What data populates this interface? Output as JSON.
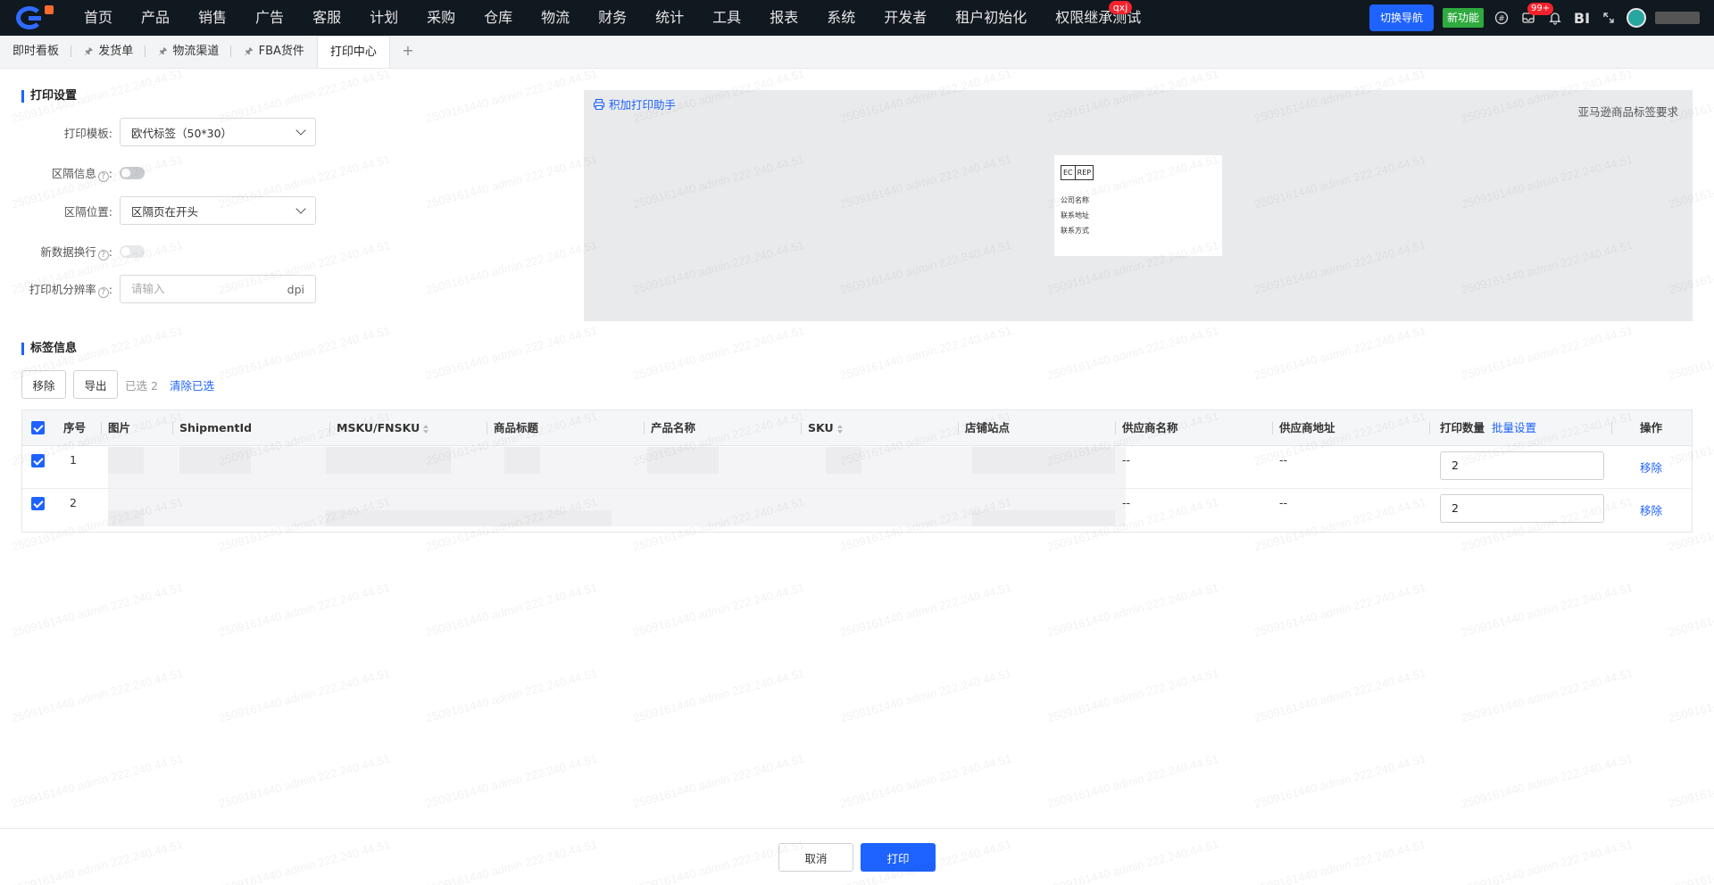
{
  "topnav": {
    "items": [
      {
        "label": "首页"
      },
      {
        "label": "产品"
      },
      {
        "label": "销售"
      },
      {
        "label": "广告"
      },
      {
        "label": "客服"
      },
      {
        "label": "计划"
      },
      {
        "label": "采购"
      },
      {
        "label": "仓库"
      },
      {
        "label": "物流"
      },
      {
        "label": "财务"
      },
      {
        "label": "统计"
      },
      {
        "label": "工具"
      },
      {
        "label": "报表"
      },
      {
        "label": "系统"
      },
      {
        "label": "开发者"
      },
      {
        "label": "租户初始化"
      },
      {
        "label": "权限继承测试",
        "badge": "qxj"
      }
    ],
    "switch_nav": "切换导航",
    "new_feature": "新功能",
    "msg_badge": "99+",
    "bi": "BI"
  },
  "tabs": [
    {
      "label": "即时看板",
      "pinned": false,
      "active": false
    },
    {
      "label": "发货单",
      "pinned": true,
      "active": false
    },
    {
      "label": "物流渠道",
      "pinned": true,
      "active": false
    },
    {
      "label": "FBA货件",
      "pinned": true,
      "active": false
    },
    {
      "label": "打印中心",
      "pinned": false,
      "active": true
    }
  ],
  "tab_add": "+",
  "print_settings": {
    "title": "打印设置",
    "template_label": "打印模板:",
    "template_value": "欧代标签（50*30）",
    "separator_info_label": "区隔信息",
    "separator_pos_label": "区隔位置:",
    "separator_pos_value": "区隔页在开头",
    "newline_label": "新数据换行",
    "dpi_label": "打印机分辨率",
    "dpi_placeholder": "请输入",
    "dpi_suffix": "dpi",
    "colon": ":"
  },
  "preview": {
    "helper_link": "积加打印助手",
    "amazon_req": "亚马逊商品标签要求",
    "ec": "EC",
    "rep": "REP",
    "company": "公司名称",
    "address": "联系地址",
    "contact": "联系方式"
  },
  "label_info": {
    "title": "标签信息",
    "remove_btn": "移除",
    "export_btn": "导出",
    "selected_text": "已选 2",
    "clear_selected": "清除已选"
  },
  "table": {
    "headers": {
      "index": "序号",
      "image": "图片",
      "shipment_id": "ShipmentId",
      "msku": "MSKU/FNSKU",
      "item_title": "商品标题",
      "product_name": "产品名称",
      "sku": "SKU",
      "store": "店铺站点",
      "supplier_name": "供应商名称",
      "supplier_addr": "供应商地址",
      "print_qty": "打印数量",
      "batch_set": "批量设置",
      "operation": "操作"
    },
    "rows": [
      {
        "index": "1",
        "supplier_name": "--",
        "supplier_addr": "--",
        "qty": "2",
        "op": "移除"
      },
      {
        "index": "2",
        "supplier_name": "--",
        "supplier_addr": "--",
        "qty": "2",
        "op": "移除"
      }
    ]
  },
  "footer": {
    "cancel": "取消",
    "print": "打印"
  },
  "watermark_text": "2509161440 admin 222.240.44.51",
  "colors": {
    "accent": "#1e62ff",
    "topbar": "#101820",
    "new_feature": "#2eaa3f",
    "badge": "#f5222d"
  }
}
